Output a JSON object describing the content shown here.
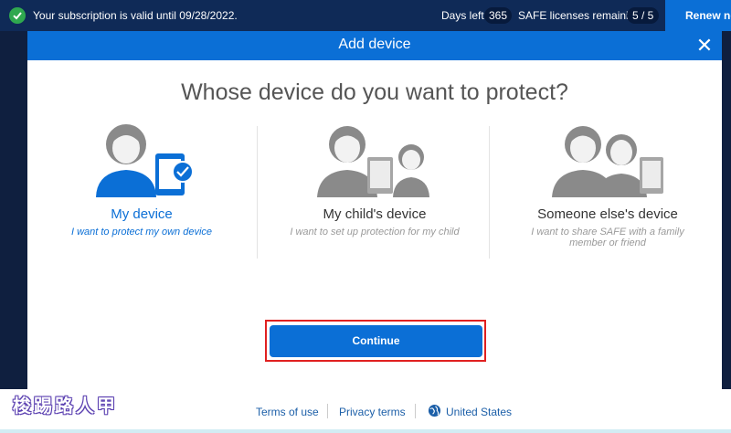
{
  "topbar": {
    "subscription_text": "Your subscription is valid until 09/28/2022.",
    "days_left_label": "Days left",
    "days_left_value": "365",
    "licenses_label": "SAFE licenses remaining",
    "licenses_value": "5 / 5",
    "renew_label": "Renew now"
  },
  "dialog": {
    "title": "Add device",
    "question": "Whose device do you want to protect?",
    "options": [
      {
        "title": "My device",
        "description": "I want to protect my own device",
        "selected": true
      },
      {
        "title": "My child's device",
        "description": "I want to set up protection for my child",
        "selected": false
      },
      {
        "title": "Someone else's device",
        "description": "I want to share SAFE with a family member or friend",
        "selected": false
      }
    ],
    "continue_label": "Continue"
  },
  "footer": {
    "terms": "Terms of use",
    "privacy": "Privacy terms",
    "region": "United States"
  },
  "watermark": "梭踢路人甲",
  "colors": {
    "accent": "#0b6fd6",
    "topbar_bg": "#0f2a57",
    "check_green": "#2fa84f",
    "highlight_outline": "#e02020"
  }
}
